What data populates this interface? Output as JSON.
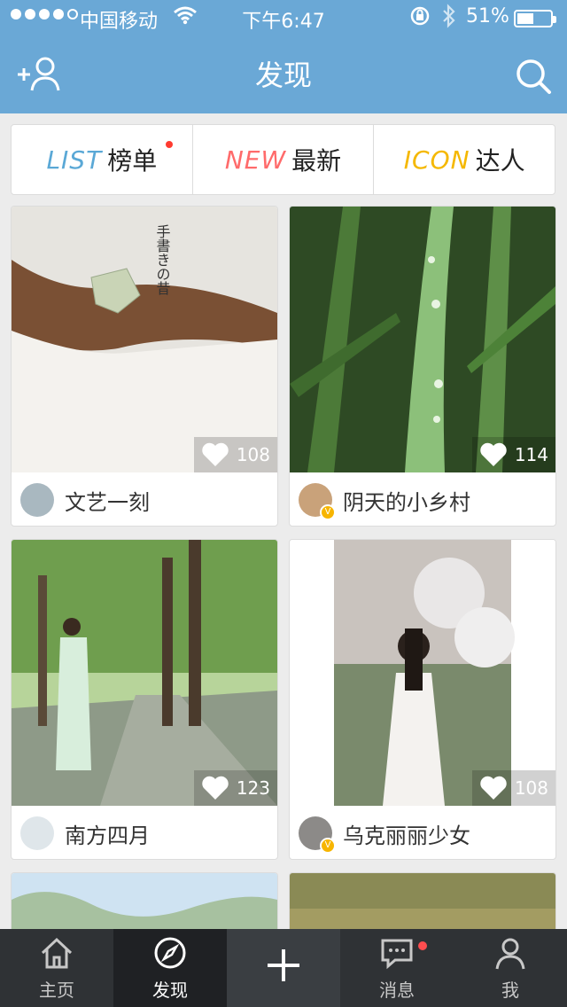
{
  "status_bar": {
    "carrier": "中国移动",
    "time": "下午6:47",
    "battery": "51%"
  },
  "nav": {
    "title": "发现"
  },
  "categories": [
    {
      "en": "LIST",
      "zh": "榜单",
      "color": "#5aa8d6",
      "has_dot": true
    },
    {
      "en": "NEW",
      "zh": "最新",
      "color": "#ff6b6b",
      "has_dot": false
    },
    {
      "en": "ICON",
      "zh": "达人",
      "color": "#f5b800",
      "has_dot": false
    }
  ],
  "cards": [
    {
      "likes": "108",
      "user": "文艺一刻",
      "verified": false
    },
    {
      "likes": "114",
      "user": "阴天的小乡村",
      "verified": true
    },
    {
      "likes": "123",
      "user": "南方四月",
      "verified": false
    },
    {
      "likes": "108",
      "user": "乌克丽丽少女",
      "verified": true
    }
  ],
  "tabbar": {
    "items": [
      {
        "label": "主页",
        "icon": "home-icon"
      },
      {
        "label": "发现",
        "icon": "compass-icon"
      },
      {
        "label": "",
        "icon": "plus-icon"
      },
      {
        "label": "消息",
        "icon": "message-icon"
      },
      {
        "label": "我",
        "icon": "user-icon"
      }
    ]
  }
}
